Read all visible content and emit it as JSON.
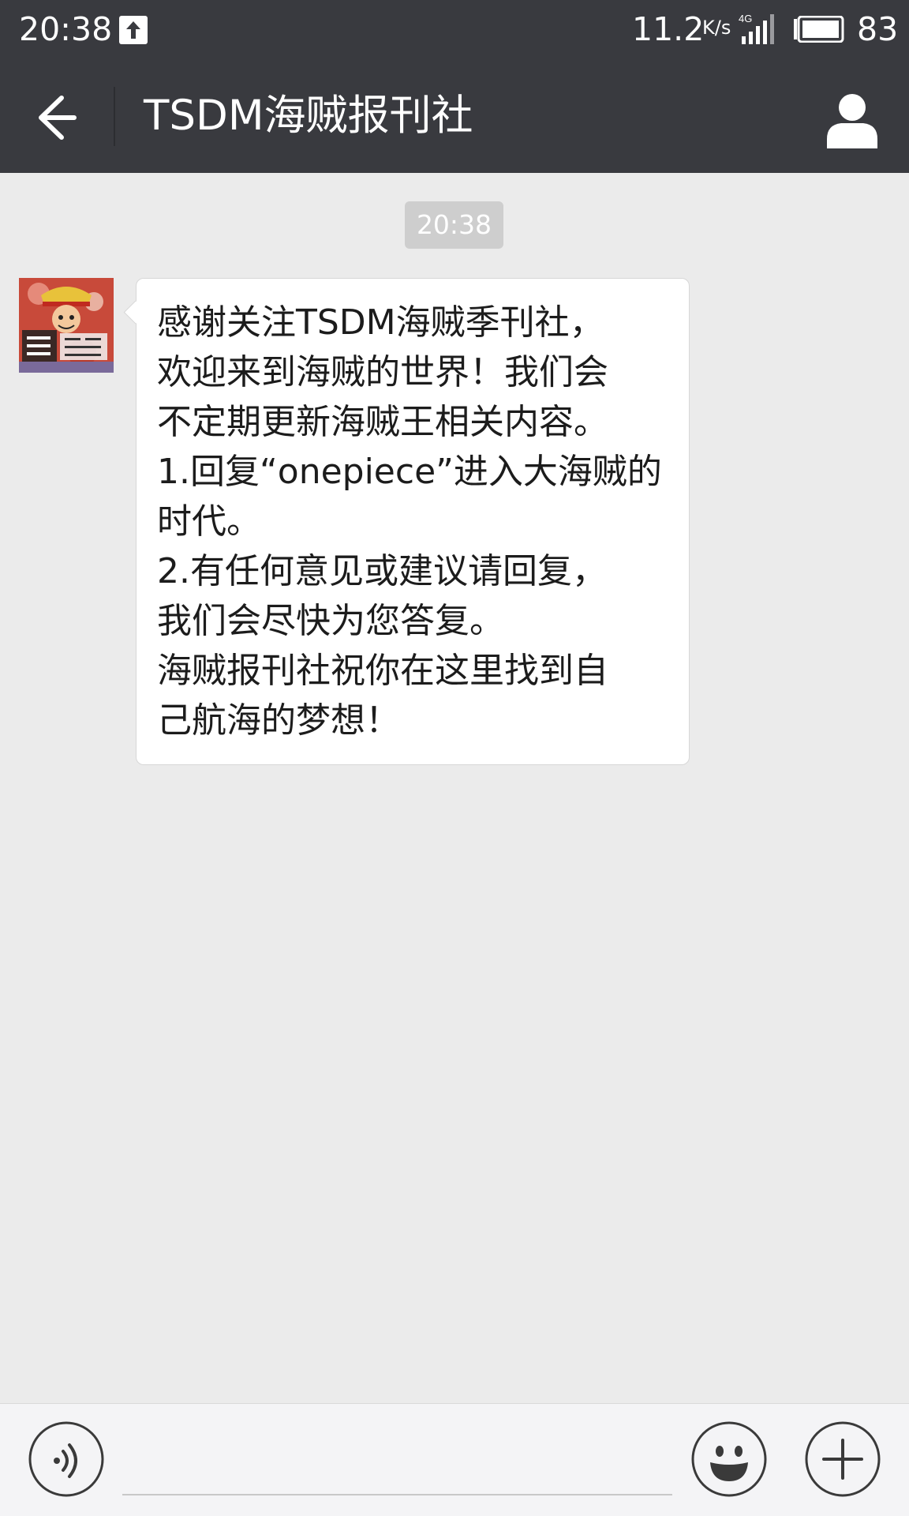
{
  "status_bar": {
    "time": "20:38",
    "net_speed": "11.2",
    "speed_unit": "K/s",
    "network_type": "4G",
    "battery": "83",
    "upload_icon": "upload-arrow-icon",
    "signal_icon": "signal-bars-icon",
    "battery_icon": "battery-icon"
  },
  "header": {
    "title": "TSDM海贼报刊社",
    "back_icon": "back-arrow-icon",
    "profile_icon": "person-icon"
  },
  "chat": {
    "timestamp": "20:38",
    "message": {
      "sender_avatar": "avatar-image",
      "lines": [
        "感谢关注TSDM海贼季刊社，",
        "欢迎来到海贼的世界！我们会",
        "不定期更新海贼王相关内容。",
        "1.回复“onepiece”进入大海贼的",
        "时代。",
        "2.有任何意见或建议请回复，",
        "我们会尽快为您答复。",
        "海贼报刊社祝你在这里找到自",
        "己航海的梦想！"
      ]
    }
  },
  "input_bar": {
    "voice_icon": "voice-icon",
    "text_value": "",
    "emoji_icon": "emoji-icon",
    "plus_icon": "plus-icon"
  },
  "colors": {
    "header_bg": "#393a3f",
    "chat_bg": "#ebebeb",
    "bubble_bg": "#ffffff",
    "timestamp_bg": "#cecece",
    "input_bar_bg": "#f4f4f6"
  }
}
